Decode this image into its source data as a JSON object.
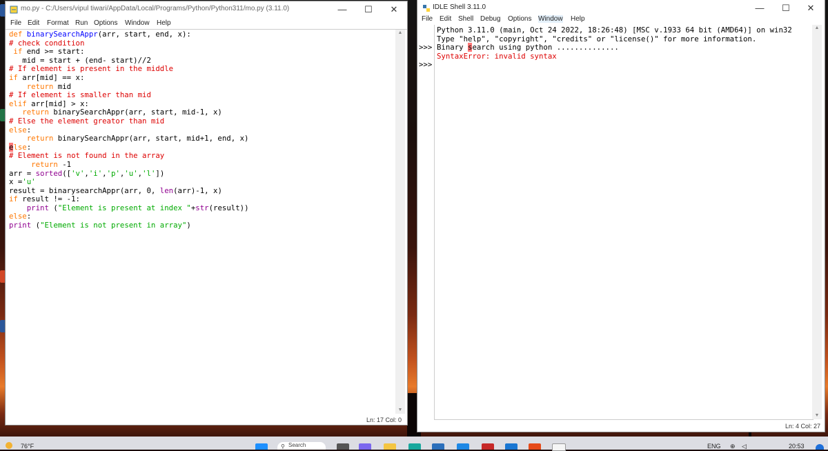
{
  "editor": {
    "title": "mo.py - C:/Users/vipul tiwari/AppData/Local/Programs/Python/Python311/mo.py (3.11.0)",
    "menu": [
      "File",
      "Edit",
      "Format",
      "Run",
      "Options",
      "Window",
      "Help"
    ],
    "lines": [
      [
        [
          "kw",
          "def "
        ],
        [
          "fn",
          "binarySearchAppr"
        ],
        [
          "",
          "(arr, start, end, x):"
        ]
      ],
      [
        [
          "cm",
          "# check condition"
        ]
      ],
      [
        [
          "",
          ""
        ],
        [
          "kw",
          " if"
        ],
        [
          "",
          " end >= start:"
        ]
      ],
      [
        [
          "",
          "   mid = start + (end- start)//2"
        ]
      ],
      [
        [
          "cm",
          "# If element is present in the middle"
        ]
      ],
      [
        [
          "kw",
          "if"
        ],
        [
          "",
          " arr[mid] == x:"
        ]
      ],
      [
        [
          "kw",
          "    return"
        ],
        [
          "",
          " mid"
        ]
      ],
      [
        [
          "cm",
          "# If element is smaller than mid"
        ]
      ],
      [
        [
          "kw",
          "elif"
        ],
        [
          "",
          " arr[mid] > x:"
        ]
      ],
      [
        [
          "kw",
          "   return"
        ],
        [
          "",
          " binarySearchAppr(arr, start, mid-1, x)"
        ]
      ],
      [
        [
          "cm",
          "# Else the element greator than mid"
        ]
      ],
      [
        [
          "kw",
          "else"
        ],
        [
          "",
          ":"
        ]
      ],
      [
        [
          "kw",
          "    return"
        ],
        [
          "",
          " binarySearchAppr(arr, start, mid+1, end, x)"
        ]
      ],
      [
        [
          "err-mark",
          "e"
        ],
        [
          "kw",
          "lse"
        ],
        [
          "",
          ":"
        ]
      ],
      [
        [
          "cm",
          "# Element is not found in the array"
        ]
      ],
      [
        [
          "kw",
          "     return"
        ],
        [
          "",
          " -1"
        ]
      ],
      [
        [
          "",
          "arr = "
        ],
        [
          "bi",
          "sorted"
        ],
        [
          "",
          "(["
        ],
        [
          "st",
          "'v'"
        ],
        [
          "",
          ","
        ],
        [
          "st",
          "'i'"
        ],
        [
          "",
          ","
        ],
        [
          "st",
          "'p'"
        ],
        [
          "",
          ","
        ],
        [
          "st",
          "'u'"
        ],
        [
          "",
          ","
        ],
        [
          "st",
          "'l'"
        ],
        [
          "",
          "])"
        ]
      ],
      [
        [
          "",
          "x ="
        ],
        [
          "st",
          "'u'"
        ]
      ],
      [
        [
          "",
          "result = binarysearchAppr(arr, 0, "
        ],
        [
          "bi",
          "len"
        ],
        [
          "",
          "(arr)-1, x)"
        ]
      ],
      [
        [
          "kw",
          "if"
        ],
        [
          "",
          " result != -1:"
        ]
      ],
      [
        [
          "",
          "    "
        ],
        [
          "bi",
          "print"
        ],
        [
          "",
          " ("
        ],
        [
          "st",
          "\"Element is present at index \""
        ],
        [
          "",
          "+"
        ],
        [
          "bi",
          "str"
        ],
        [
          "",
          "(result))"
        ]
      ],
      [
        [
          "kw",
          "else"
        ],
        [
          "",
          ":"
        ]
      ],
      [
        [
          "bi",
          "print"
        ],
        [
          "",
          " ("
        ],
        [
          "st",
          "\"Element is not present in array\""
        ],
        [
          "",
          ")"
        ]
      ]
    ],
    "status": "Ln: 17  Col: 0"
  },
  "shell": {
    "title": "IDLE Shell 3.11.0",
    "menu": [
      "File",
      "Edit",
      "Shell",
      "Debug",
      "Options",
      "Window",
      "Help"
    ],
    "prompt": ">>>",
    "lines": [
      {
        "prompt": "",
        "text": "Python 3.11.0 (main, Oct 24 2022, 18:26:48) [MSC v.1933 64 bit (AMD64)] on win32",
        "cls": ""
      },
      {
        "prompt": "",
        "text": "Type \"help\", \"copyright\", \"credits\" or \"license()\" for more information.",
        "cls": ""
      },
      {
        "prompt": ">>>",
        "text": "Binary search using python ..............",
        "cls": "",
        "mark": "s"
      },
      {
        "prompt": "",
        "text": "SyntaxError: invalid syntax",
        "cls": "err"
      },
      {
        "prompt": ">>>",
        "text": "",
        "cls": ""
      }
    ],
    "status": "Ln: 4  Col: 27"
  },
  "taskbar": {
    "weather": "76°F",
    "search": "Search",
    "lang": "ENG",
    "time": "20:53"
  },
  "colors": {
    "keyword": "#ff7700",
    "function": "#0000ff",
    "comment": "#dd0000",
    "string": "#00aa00",
    "builtin": "#900090"
  }
}
